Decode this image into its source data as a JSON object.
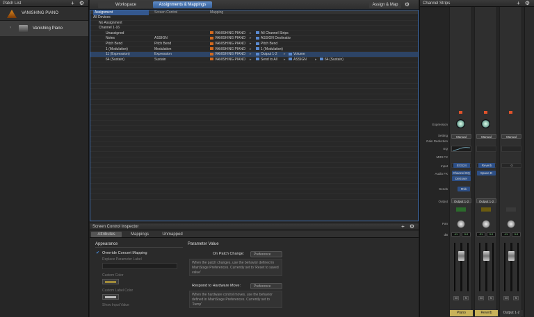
{
  "patch_list": {
    "title": "Patch List",
    "concert_name": "VANISHING PIANO",
    "patches": [
      "Vanishing Piano"
    ]
  },
  "workspace": {
    "tabs": [
      "Workspace",
      "Assignments & Mappings"
    ],
    "assign_map_label": "Assign & Map",
    "columns": [
      "Assignment",
      "Screen Control",
      "Mapping"
    ],
    "tree": [
      "All Devices",
      "No Assignment",
      "Channel 1-16"
    ],
    "rows": [
      {
        "assignment": "Unassigned",
        "control": "",
        "mapping": "VANISHING PIANO",
        "target": "All Channel Strips",
        "param": ""
      },
      {
        "assignment": "Notes",
        "control": "ASSIGN",
        "mapping": "VANISHING PIANO",
        "target": "ASSIGN Destinations",
        "param": ""
      },
      {
        "assignment": "Pitch Bend",
        "control": "Pitch Bend",
        "mapping": "VANISHING PIANO",
        "target": "Pitch Bend",
        "param": ""
      },
      {
        "assignment": "1 (Modulation)",
        "control": "Modulation",
        "mapping": "VANISHING PIANO",
        "target": "1 (Modulation)",
        "param": ""
      },
      {
        "assignment": "11 (Expression)",
        "control": "Expression",
        "mapping": "VANISHING PIANO",
        "target": "Output 1-2",
        "param": "Volume"
      },
      {
        "assignment": "64 (Sustain)",
        "control": "Sustain",
        "mapping": "VANISHING PIANO",
        "target": "Send to All",
        "param": "ASSIGN",
        "extra": "64 (Sustain)"
      }
    ]
  },
  "inspector": {
    "title": "Screen Control Inspector",
    "tabs": [
      "Attributes",
      "Mappings",
      "Unmapped"
    ],
    "appearance_title": "Appearance",
    "override_label": "Override Concert Mapping",
    "replace_label": "Replace Parameter Label",
    "custom_color_label": "Custom Color",
    "custom_label_color_label": "Custom Label Color",
    "show_input_label": "Show Input Value",
    "param_value_title": "Parameter Value",
    "on_patch_change_label": "On Patch Change:",
    "on_patch_change_value": "Preference",
    "on_patch_change_desc": "When the patch changes, use the behavior defined in MainStage Preferences. Currently set to 'Reset to saved value'",
    "respond_label": "Respond to Hardware Move:",
    "respond_value": "Preference",
    "respond_desc": "When the hardware control moves, use the behavior defined in MainStage Preferences. Currently set to 'Jump'"
  },
  "channel_strips": {
    "title": "Channel Strips",
    "row_labels": [
      "Expression",
      "Setting",
      "Gain Reduction",
      "EQ",
      "MIDI FX",
      "Input",
      "Audio FX",
      "Sends",
      "Output",
      "Pan",
      "dB"
    ],
    "strips": [
      {
        "name": "Piano",
        "setting": "Manual",
        "input": "EXS24",
        "fx1": "Channel EQ",
        "fx2": "DeEsser",
        "send": "Rvb",
        "output": "Output 1-2",
        "db1": "-11",
        "db2": "0.0",
        "color": "#c8b25a"
      },
      {
        "name": "Reverb",
        "setting": "Manual",
        "input": "Reverb",
        "fx1": "Space D",
        "fx2": "",
        "send": "",
        "output": "Output 1-2",
        "db1": "-21",
        "db2": "0.0",
        "color": "#c8b25a"
      },
      {
        "name": "Output 1-2",
        "setting": "Manual",
        "input": "",
        "fx1": "",
        "fx2": "",
        "send": "",
        "output": "",
        "db1": "-11",
        "db2": "0.0",
        "color": "#2f2f2f"
      }
    ]
  }
}
